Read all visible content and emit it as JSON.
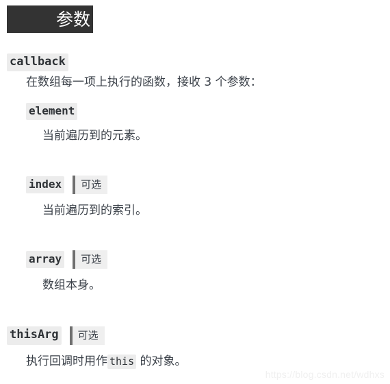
{
  "heading": {
    "text": "参数",
    "background_color": "#333333",
    "text_color": "#ffffff"
  },
  "colors": {
    "code_chip_background": "#ececec",
    "optional_badge_background": "#efefef",
    "optional_badge_bar": "#6f6f6f",
    "body_text": "#3b4149",
    "page_background": "#ffffff",
    "watermark": "#f0f0f0"
  },
  "params": [
    {
      "name": "callback",
      "optional": false,
      "optional_label": "",
      "description": "在数组每一项上执行的函数，接收 3 个参数："
    },
    {
      "name": "element",
      "optional": false,
      "optional_label": "",
      "description": "当前遍历到的元素。"
    },
    {
      "name": "index",
      "optional": true,
      "optional_label": "可选",
      "description": "当前遍历到的索引。"
    },
    {
      "name": "array",
      "optional": true,
      "optional_label": "可选",
      "description": "数组本身。"
    },
    {
      "name": "thisArg",
      "optional": true,
      "optional_label": "可选",
      "description_prefix": "执行回调时用作",
      "description_code": "this",
      "description_suffix": " 的对象。"
    }
  ],
  "watermark": {
    "text": "https://blog.csdn.net/wdhxs"
  }
}
